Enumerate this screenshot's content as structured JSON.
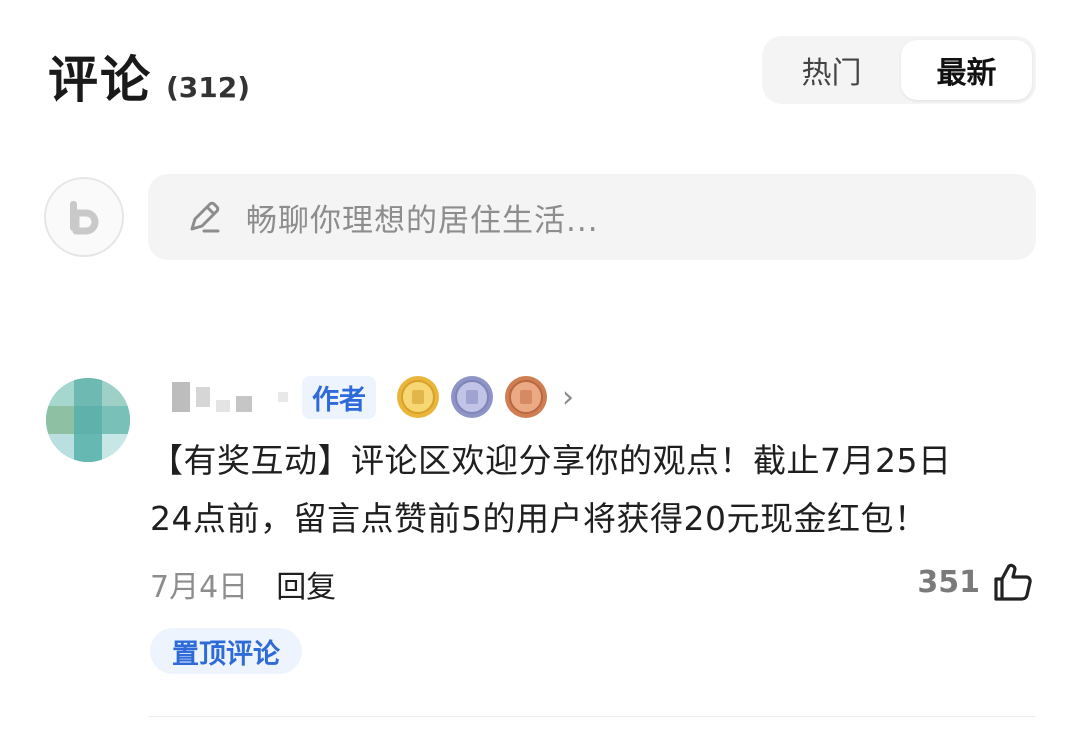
{
  "header": {
    "title": "评论",
    "count": "(312)"
  },
  "sort_tabs": [
    {
      "label": "热门",
      "active": false
    },
    {
      "label": "最新",
      "active": true
    }
  ],
  "composer": {
    "placeholder": "畅聊你理想的居住生活..."
  },
  "comment": {
    "author_badge": "作者",
    "text_line1": "【有奖互动】评论区欢迎分享你的观点！截止7月25日",
    "text_line2": "24点前，留言点赞前5的用户将获得20元现金红包！",
    "date": "7月4日",
    "reply_label": "回复",
    "like_count": "351",
    "pinned_label": "置顶评论",
    "medals": [
      "gold-medal",
      "silver-medal",
      "bronze-medal"
    ]
  },
  "colors": {
    "accent": "#2f6bd8",
    "badge_bg": "#eef4fe",
    "muted": "#8d8d8d"
  }
}
